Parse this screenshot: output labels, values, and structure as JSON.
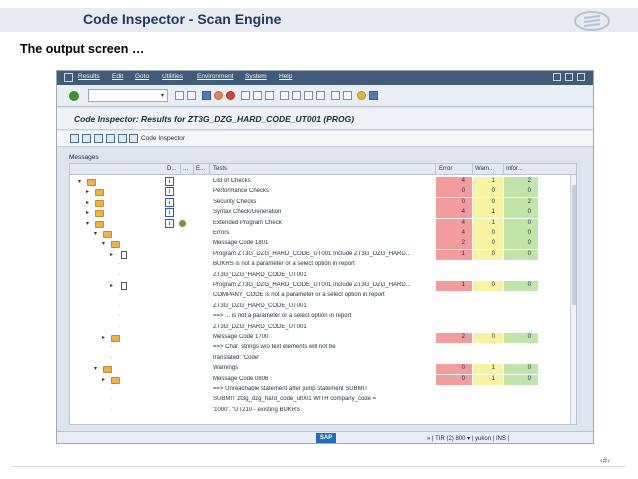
{
  "slide": {
    "title": "Code Inspector - Scan Engine",
    "subtitle": "The output screen …",
    "page_number": "‹#›"
  },
  "menu": {
    "items": [
      "Results",
      "Edit",
      "Goto",
      "Utilities",
      "Environment",
      "System",
      "Help"
    ]
  },
  "window_title": "Code Inspector: Results for ZT3G_DZG_HARD_CODE_UT001 (PROG)",
  "app_toolbar_label": "Code Inspector",
  "messages_label": "Messages",
  "grid": {
    "headers": {
      "d": "D...",
      "dots": "...",
      "e": "E...",
      "tests": "Tests",
      "error": "Error",
      "warn": "Warn...",
      "info": "Infor..."
    },
    "rows": [
      {
        "tree": "▾",
        "folder": true,
        "icon": "info",
        "text": "List of Checks",
        "error": "4",
        "warn": "1",
        "info": "2"
      },
      {
        "tree": "▸",
        "folder": true,
        "icon": "info",
        "text": "Performance Checks",
        "error": "0",
        "warn": "0",
        "info": "0"
      },
      {
        "tree": "▸",
        "folder": true,
        "icon": "info",
        "text": "Security Checks",
        "error": "0",
        "warn": "0",
        "info": "2"
      },
      {
        "tree": "▸",
        "folder": true,
        "icon": "info",
        "text": "Syntax Check/Generation",
        "error": "4",
        "warn": "1",
        "info": "0"
      },
      {
        "tree": "▾",
        "folder": true,
        "icon": "ext",
        "text": "Extended Program Check",
        "error": "4",
        "warn": "1",
        "info": "0"
      },
      {
        "tree": "▾",
        "folder": true,
        "icon": "",
        "text": "Errors",
        "error": "4",
        "warn": "0",
        "info": "0"
      },
      {
        "tree": "▾",
        "folder": true,
        "icon": "",
        "text": "Message Code 1801",
        "error": "2",
        "warn": "0",
        "info": "0"
      },
      {
        "tree": "▸",
        "doc": true,
        "icon": "",
        "text": "Program ZT3G_DZG_HARD_CODE_UT001 Include ZT3G_DZG_HARD...",
        "error": "1",
        "warn": "0",
        "info": "0"
      },
      {
        "tree": "·",
        "icon": "",
        "text": "BUKRS is not a parameter or a select option in report",
        "error": "",
        "warn": "",
        "info": ""
      },
      {
        "tree": "·",
        "icon": "",
        "text": "ZT3G_DZG_HARD_CODE_UT001",
        "error": "",
        "warn": "",
        "info": ""
      },
      {
        "tree": "▸",
        "doc": true,
        "icon": "",
        "text": "Program ZT3G_DZG_HARD_CODE_UT001 Include ZT3G_DZG_HARD...",
        "error": "1",
        "warn": "0",
        "info": "0"
      },
      {
        "tree": "·",
        "icon": "",
        "text": "COMPANY_CODE is not a parameter or a select option in report",
        "error": "",
        "warn": "",
        "info": ""
      },
      {
        "tree": "·",
        "icon": "",
        "text": "ZT3G_DZG_HARD_CODE_UT001",
        "error": "",
        "warn": "",
        "info": ""
      },
      {
        "tree": "·",
        "icon": "",
        "text": "==> ... is not a parameter or a select option in report",
        "error": "",
        "warn": "",
        "info": ""
      },
      {
        "tree": "·",
        "icon": "",
        "text": "ZT3G_DZG_HARD_CODE_UT001",
        "error": "",
        "warn": "",
        "info": ""
      },
      {
        "tree": "▸",
        "folder": true,
        "icon": "",
        "text": "Message Code 1700",
        "error": "2",
        "warn": "0",
        "info": "0"
      },
      {
        "tree": "·",
        "icon": "",
        "text": "==> Char. strings w/o text elements will not be",
        "error": "",
        "warn": "",
        "info": ""
      },
      {
        "tree": "·",
        "icon": "",
        "text": "translated: 'Code'",
        "error": "",
        "warn": "",
        "info": ""
      },
      {
        "tree": "▾",
        "folder": true,
        "icon": "",
        "text": "Warnings",
        "error": "0",
        "warn": "1",
        "info": "0"
      },
      {
        "tree": "▸",
        "folder": true,
        "icon": "",
        "text": "Message Code 0806",
        "error": "0",
        "warn": "1",
        "info": "0"
      },
      {
        "tree": "·",
        "icon": "",
        "text": "==> Unreachable statement after jump statement SUBMIT",
        "error": "",
        "warn": "",
        "info": ""
      },
      {
        "tree": "·",
        "icon": "",
        "text": "SUBMIT zt3g_dzg_hard_code_ut001 WITH        company_code =",
        "error": "",
        "warn": "",
        "info": ""
      },
      {
        "tree": "·",
        "icon": "",
        "text": "'1000'. \"UT210 - existing BUKRS",
        "error": "",
        "warn": "",
        "info": ""
      }
    ]
  },
  "status": {
    "sap_label": "SAP",
    "text": "» | TIR (2) 800 ▾ | yukon | INS |"
  },
  "colors": {
    "error_bg": "#f49b9b",
    "warn_bg": "#f8f3a0",
    "info_bg": "#bfe6a8",
    "menubar": "#3f5b7a"
  }
}
